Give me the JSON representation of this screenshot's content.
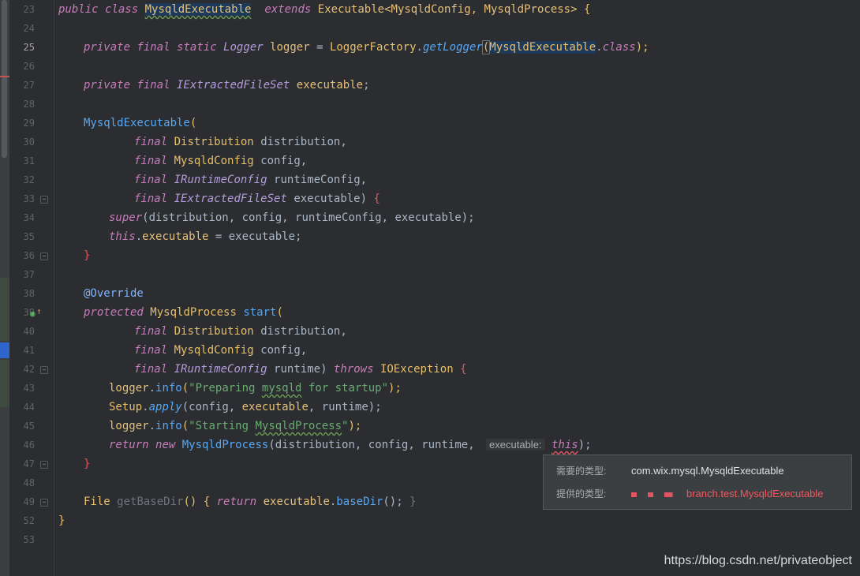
{
  "editor": {
    "current_line": 25,
    "lines": [
      {
        "n": "23"
      },
      {
        "n": "24"
      },
      {
        "n": "25"
      },
      {
        "n": "26"
      },
      {
        "n": "27"
      },
      {
        "n": "28"
      },
      {
        "n": "29"
      },
      {
        "n": "30"
      },
      {
        "n": "31"
      },
      {
        "n": "32"
      },
      {
        "n": "33"
      },
      {
        "n": "34"
      },
      {
        "n": "35"
      },
      {
        "n": "36"
      },
      {
        "n": "37"
      },
      {
        "n": "38"
      },
      {
        "n": "39"
      },
      {
        "n": "40"
      },
      {
        "n": "41"
      },
      {
        "n": "42"
      },
      {
        "n": "43"
      },
      {
        "n": "44"
      },
      {
        "n": "45"
      },
      {
        "n": "46"
      },
      {
        "n": "47"
      },
      {
        "n": "48"
      },
      {
        "n": "49"
      },
      {
        "n": "52"
      },
      {
        "n": "53"
      }
    ],
    "code": {
      "l23": {
        "public": "public",
        "class": "class",
        "name": "MysqldExecutable",
        "extends": "extends",
        "base": "Executable",
        "lt": "<",
        "g1": "MysqldConfig",
        "comma": ", ",
        "g2": "MysqldProcess",
        "gt": ">",
        "brace": " {"
      },
      "l25": {
        "private": "private",
        "final": "final",
        "static": "static",
        "type": "Logger",
        "var": "logger",
        "eq": " = ",
        "cls": "LoggerFactory",
        "dot": ".",
        "meth": "getLogger",
        "lp": "(",
        "arg": "MysqldExecutable",
        "dot2": ".",
        "kw": "class",
        "end": ");"
      },
      "l27": {
        "private": "private",
        "final": "final",
        "type": "IExtractedFileSet",
        "var": "executable",
        "end": ";"
      },
      "l29": {
        "ctor": "MysqldExecutable",
        "lp": "("
      },
      "l30": {
        "final": "final",
        "type": "Distribution",
        "param": "distribution",
        "end": ","
      },
      "l31": {
        "final": "final",
        "type": "MysqldConfig",
        "param": "config",
        "end": ","
      },
      "l32": {
        "final": "final",
        "type": "IRuntimeConfig",
        "param": "runtimeConfig",
        "end": ","
      },
      "l33": {
        "final": "final",
        "type": "IExtractedFileSet",
        "param": "executable",
        "end": ") ",
        "brace": "{"
      },
      "l34": {
        "super": "super",
        "args": "(distribution, config, runtimeConfig, executable);"
      },
      "l35": {
        "this": "this",
        "dot": ".",
        "field": "executable",
        "rest": " = executable;"
      },
      "l36": {
        "brace": "}"
      },
      "l38": {
        "ann": "@Override"
      },
      "l39": {
        "protected": "protected",
        "type": "MysqldProcess",
        "meth": "start",
        "lp": "("
      },
      "l40": {
        "final": "final",
        "type": "Distribution",
        "param": "distribution",
        "end": ","
      },
      "l41": {
        "final": "final",
        "type": "MysqldConfig",
        "param": "config",
        "end": ","
      },
      "l42": {
        "final": "final",
        "type": "IRuntimeConfig",
        "param": "runtime",
        "end": ") ",
        "throws": "throws",
        "exc": "IOException",
        "brace": " {"
      },
      "l43": {
        "obj": "logger",
        "dot": ".",
        "meth": "info",
        "lp": "(",
        "s1": "\"Preparing ",
        "s2": "mysqld",
        "s3": " for startup\"",
        "end": ");"
      },
      "l44": {
        "obj": "Setup",
        "dot": ".",
        "meth": "apply",
        "lp": "(config, ",
        "field": "executable",
        "end": ", runtime);"
      },
      "l45": {
        "obj": "logger",
        "dot": ".",
        "meth": "info",
        "lp": "(",
        "s1": "\"Starting ",
        "s2": "MysqldProcess",
        "s3": "\"",
        "end": ");"
      },
      "l46": {
        "return": "return",
        "new": "new",
        "type": "MysqldProcess",
        "args": "(distribution, config, runtime, ",
        "hint": "executable:",
        "this": "this",
        "end": ");"
      },
      "l47": {
        "brace": "}"
      },
      "l49": {
        "type": "File",
        "meth": "getBaseDir",
        "p": "() { ",
        "return": "return",
        "field": "executable",
        "dot": ".",
        "meth2": "baseDir",
        "end": "(); ",
        "close": "}"
      },
      "l52": {
        "brace": "}"
      }
    }
  },
  "tooltip": {
    "required_label": "需要的类型:",
    "required_value": "com.wix.mysql.MysqldExecutable",
    "provided_label": "提供的类型:",
    "provided_value": "branch.test.MysqldExecutable"
  },
  "watermark": "https://blog.csdn.net/privateobject",
  "colors": {
    "background": "#2b2d30",
    "keyword": "#c77dbb",
    "type": "#e8bf6a",
    "method": "#56a8f5",
    "string": "#6aab73",
    "error": "#f0575f"
  }
}
